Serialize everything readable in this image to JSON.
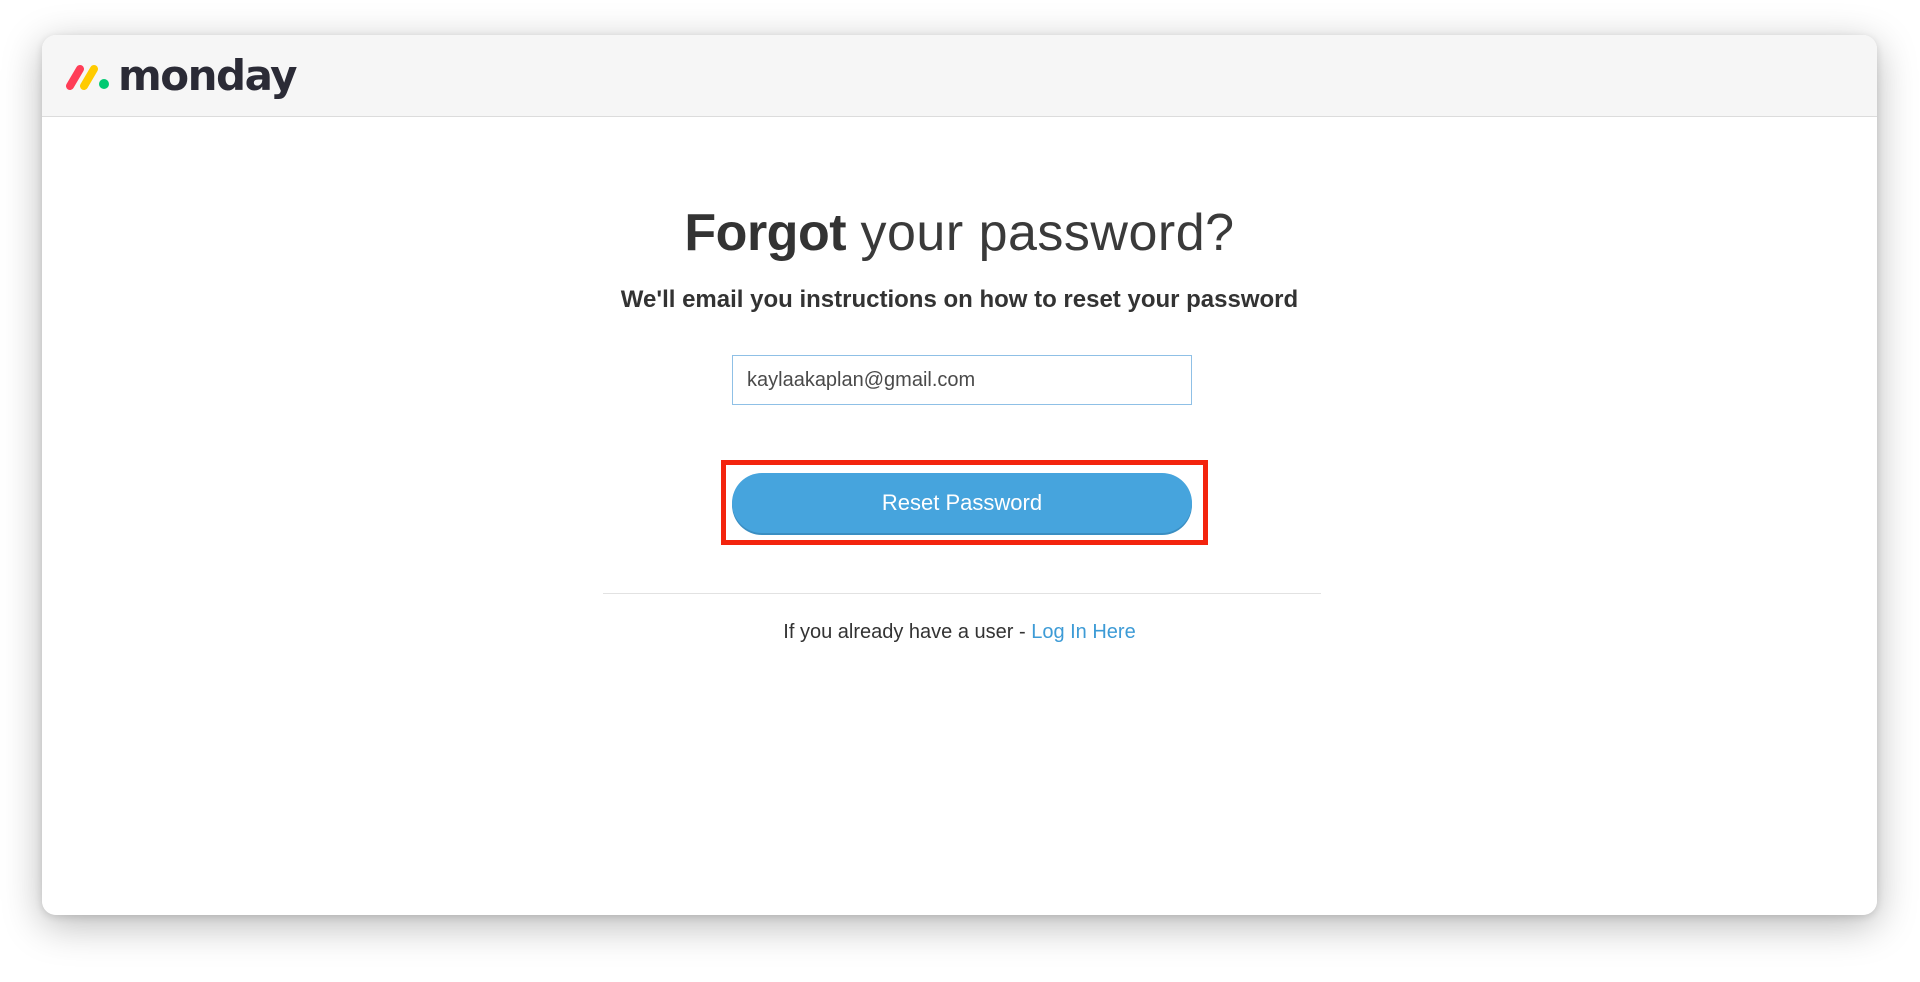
{
  "brand": {
    "name": "monday",
    "colors": {
      "mark_red": "#ff3d57",
      "mark_yellow": "#ffcb00",
      "mark_green": "#00ca72",
      "text": "#2b2b36"
    }
  },
  "form": {
    "heading_bold": "Forgot",
    "heading_light": "your password?",
    "subheading": "We'll email you instructions on how to reset your password",
    "email_value": "kaylaakaplan@gmail.com",
    "submit_label": "Reset Password",
    "login_prompt": "If you already have a user -",
    "login_link": "Log In Here"
  },
  "colors": {
    "button": "#46a4dd",
    "link": "#3d9bd6",
    "highlight_box": "#f3240e"
  }
}
